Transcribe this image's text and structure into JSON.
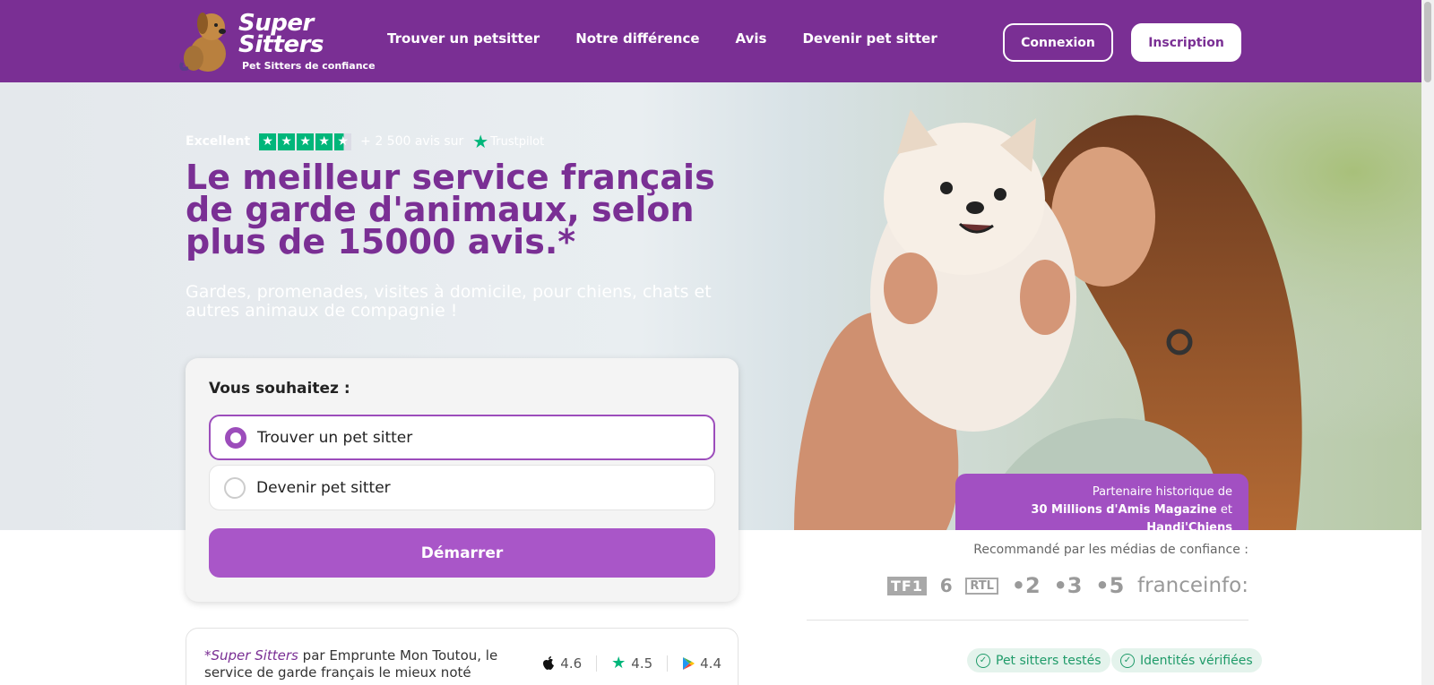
{
  "brand": {
    "line1": "Super",
    "line2": "Sitters",
    "tagline": "Pet Sitters de confiance"
  },
  "nav": {
    "items": [
      {
        "label": "Trouver un petsitter"
      },
      {
        "label": "Notre différence"
      },
      {
        "label": "Avis"
      },
      {
        "label": "Devenir pet sitter"
      }
    ],
    "login_label": "Connexion",
    "signup_label": "Inscription"
  },
  "trustpilot": {
    "rating_word": "Excellent",
    "count_text": "+ 2 500 avis sur",
    "logo_text": "Trustpilot"
  },
  "hero": {
    "title": "Le meilleur service français de garde d'animaux, selon plus de 15000 avis.*",
    "subtitle": "Gardes, promenades, visites à domicile, pour chiens, chats et autres animaux de compagnie !"
  },
  "form": {
    "question": "Vous souhaitez :",
    "options": [
      {
        "label": "Trouver un pet sitter",
        "selected": true
      },
      {
        "label": "Devenir pet sitter",
        "selected": false
      }
    ],
    "start_label": "Démarrer"
  },
  "partner": {
    "line1": "Partenaire historique de",
    "name1": "30 Millions d'Amis Magazine",
    "joiner": "et",
    "name2": "Handi'Chiens"
  },
  "media": {
    "label": "Recommandé par les médias de confiance :",
    "logos": [
      "TF1",
      "6",
      "RTL",
      "•2",
      "•3",
      "•5",
      "franceinfo:"
    ]
  },
  "badges": [
    "Pet sitters testés",
    "Identités vérifiées"
  ],
  "footnote": {
    "brand": "*Super Sitters",
    "text": "par Emprunte Mon Toutou, le service de garde français le mieux noté"
  },
  "ratings": [
    {
      "icon": "apple-icon",
      "value": "4.6"
    },
    {
      "icon": "trustpilot-star-icon",
      "value": "4.5"
    },
    {
      "icon": "google-play-icon",
      "value": "4.4"
    }
  ],
  "colors": {
    "brand_purple": "#7a2f94",
    "button_purple": "#a956c8",
    "trustpilot_green": "#00b67a",
    "badge_green": "#1f9b69"
  }
}
